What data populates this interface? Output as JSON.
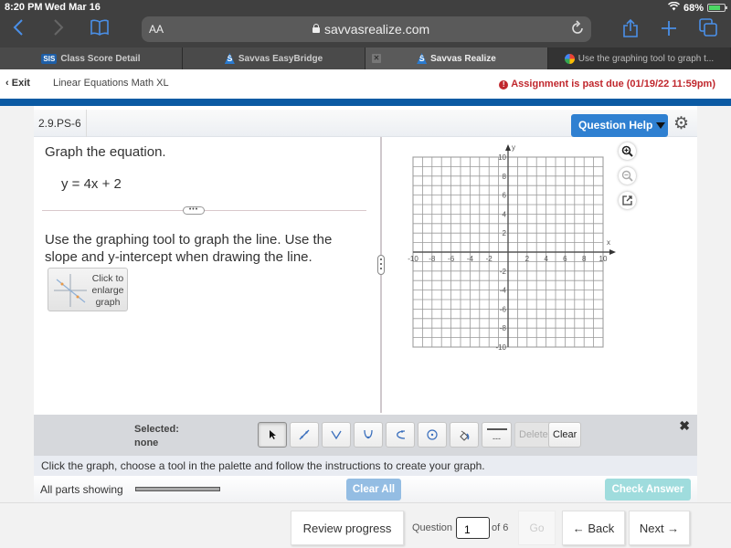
{
  "status_bar": {
    "time": "8:20 PM",
    "date": "Wed Mar 16",
    "battery": "68%",
    "battery_level": 0.68
  },
  "browser": {
    "text_size_label": "AA",
    "url": "savvasrealize.com",
    "tabs": [
      {
        "label": "Class Score Detail",
        "icon": "SIS"
      },
      {
        "label": "Savvas EasyBridge",
        "icon": "S"
      },
      {
        "label": "Savvas Realize",
        "icon": "S",
        "active": true
      },
      {
        "label": "Use the graphing tool to graph t...",
        "icon": "google"
      }
    ]
  },
  "header": {
    "exit_label": "Exit",
    "course_title": "Linear Equations Math XL",
    "past_due": "Assignment is past due (01/19/22 11:59pm)",
    "accent_color": "#0b5aa3",
    "alert_color": "#c0272d"
  },
  "question": {
    "id": "2.9.PS-6",
    "help_label": "Question Help",
    "prompt": "Graph the equation.",
    "equation": "y = 4x + 2",
    "divider_grip": "•••",
    "instructions": "Use the graphing tool to graph the line. Use the slope and y-intercept when drawing the line.",
    "enlarge_label": "Click to enlarge graph"
  },
  "chart_data": {
    "type": "scatter",
    "title": "",
    "xlabel": "x",
    "ylabel": "y",
    "xlim": [
      -10,
      10
    ],
    "ylim": [
      -10,
      10
    ],
    "grid": true,
    "grid_step": 1,
    "x_ticks": [
      -10,
      -8,
      -6,
      -4,
      -2,
      2,
      4,
      6,
      8,
      10
    ],
    "y_ticks": [
      -10,
      -8,
      -6,
      -4,
      -2,
      2,
      4,
      6,
      8,
      10
    ],
    "series": []
  },
  "palette": {
    "selected_label": "Selected:",
    "selected_value": "none",
    "tools": [
      {
        "name": "pointer",
        "glyph": "pointer"
      },
      {
        "name": "line",
        "glyph": "line"
      },
      {
        "name": "absolute-value",
        "glyph": "V"
      },
      {
        "name": "parabola",
        "glyph": "U"
      },
      {
        "name": "sideways-parabola",
        "glyph": "C"
      },
      {
        "name": "circle",
        "glyph": "circle"
      },
      {
        "name": "fill",
        "glyph": "fill"
      },
      {
        "name": "line-style",
        "glyph": "solid-dashed",
        "dashed_text": "---"
      }
    ],
    "delete_label": "Delete",
    "clear_label": "Clear",
    "close_glyph": "✖"
  },
  "hint_text": "Click the graph, choose a tool in the palette and follow the instructions to create your graph.",
  "parts": {
    "label": "All parts showing",
    "clear_all_label": "Clear All",
    "check_answer_label": "Check Answer"
  },
  "footer": {
    "review_label": "Review progress",
    "question_label": "Question",
    "question_value": "1",
    "of_label": "of 6",
    "go_label": "Go",
    "back_label": "← Back",
    "next_label": "Next →"
  }
}
